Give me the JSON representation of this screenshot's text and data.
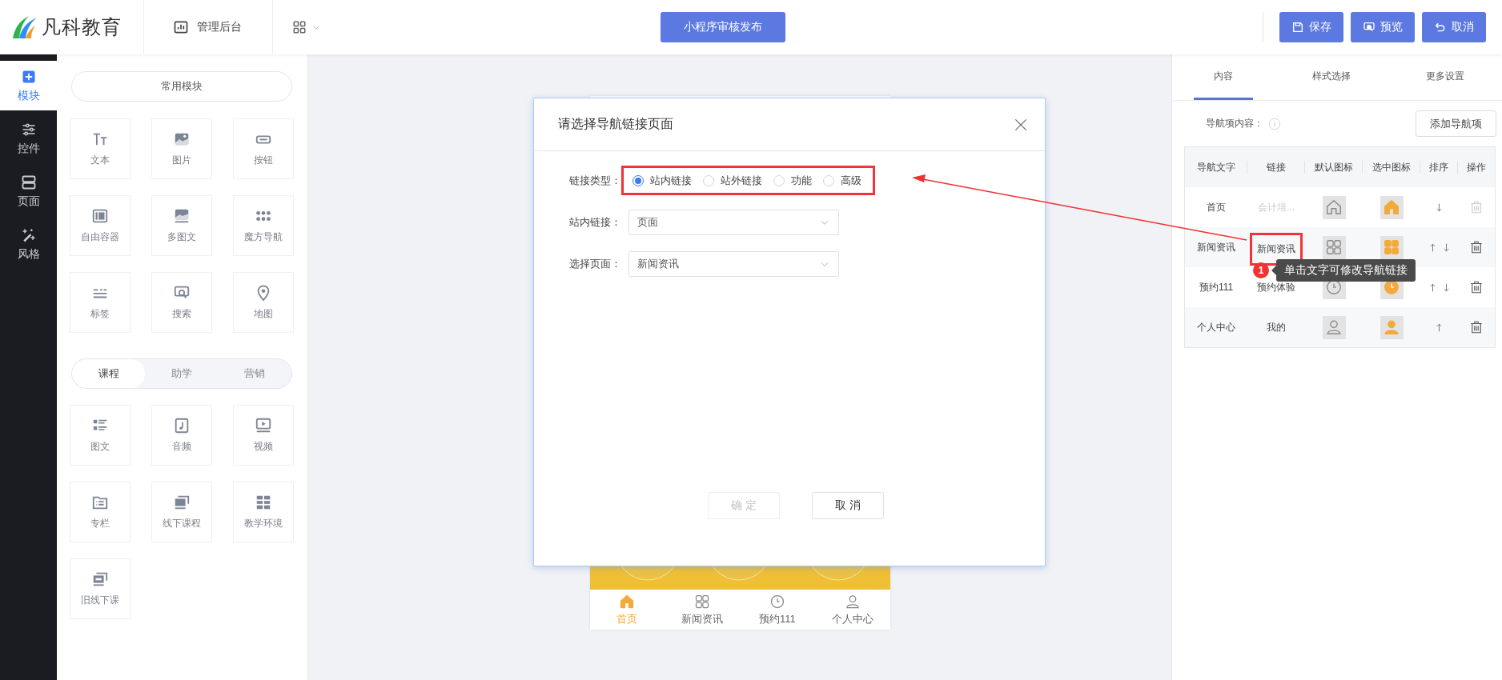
{
  "header": {
    "logo_text": "凡科教育",
    "admin_link": "管理后台",
    "publish_button": "小程序审核发布",
    "actions": [
      {
        "label": "保存",
        "kind": "save"
      },
      {
        "label": "预览",
        "kind": "search"
      },
      {
        "label": "取消",
        "kind": "undo"
      }
    ]
  },
  "rail": [
    {
      "label": "模块",
      "kind": "plus",
      "selected": true
    },
    {
      "label": "控件",
      "kind": "sliders",
      "selected": false
    },
    {
      "label": "页面",
      "kind": "page",
      "selected": false
    },
    {
      "label": "风格",
      "kind": "magic",
      "selected": false
    }
  ],
  "modules": {
    "common_title": "常用模块",
    "common": [
      {
        "label": "文本",
        "kind": "text"
      },
      {
        "label": "图片",
        "kind": "image"
      },
      {
        "label": "按钮",
        "kind": "button"
      },
      {
        "label": "自由容器",
        "kind": "container"
      },
      {
        "label": "多图文",
        "kind": "multi"
      },
      {
        "label": "魔方导航",
        "kind": "dots"
      },
      {
        "label": "标签",
        "kind": "tag"
      },
      {
        "label": "搜索",
        "kind": "search"
      },
      {
        "label": "地图",
        "kind": "map"
      }
    ],
    "tabs": [
      {
        "label": "课程",
        "selected": true
      },
      {
        "label": "助学",
        "selected": false
      },
      {
        "label": "营销",
        "selected": false
      }
    ],
    "course": [
      {
        "label": "图文",
        "kind": "list"
      },
      {
        "label": "音频",
        "kind": "audio"
      },
      {
        "label": "视频",
        "kind": "video"
      },
      {
        "label": "专栏",
        "kind": "folder"
      },
      {
        "label": "线下课程",
        "kind": "screens"
      },
      {
        "label": "教学环境",
        "kind": "tiles"
      },
      {
        "label": "旧线下课",
        "kind": "old"
      }
    ]
  },
  "phone": {
    "tabs": [
      {
        "label": "首页",
        "kind": "home",
        "selected": true
      },
      {
        "label": "新闻资讯",
        "kind": "grid",
        "selected": false
      },
      {
        "label": "预约111",
        "kind": "clock",
        "selected": false
      },
      {
        "label": "个人中心",
        "kind": "user",
        "selected": false
      }
    ]
  },
  "dialog": {
    "title": "请选择导航链接页面",
    "fields": [
      {
        "label": "链接类型：",
        "kind": "radio",
        "highlighted": true,
        "options": [
          {
            "label": "站内链接",
            "selected": true
          },
          {
            "label": "站外链接",
            "selected": false
          },
          {
            "label": "功能",
            "selected": false
          },
          {
            "label": "高级",
            "selected": false
          }
        ]
      },
      {
        "label": "站内链接：",
        "kind": "select",
        "value": "页面"
      },
      {
        "label": "选择页面：",
        "kind": "select",
        "value": "新闻资讯"
      }
    ],
    "buttons": [
      {
        "label": "确 定",
        "disabled": true
      },
      {
        "label": "取 消",
        "disabled": false
      }
    ]
  },
  "panel": {
    "tabs": [
      {
        "label": "内容",
        "selected": true
      },
      {
        "label": "样式选择",
        "selected": false
      },
      {
        "label": "更多设置",
        "selected": false
      }
    ],
    "section_label": "导航项内容：",
    "add_button": "添加导航项",
    "columns": [
      "导航文字",
      "链接",
      "默认图标",
      "选中图标",
      "排序",
      "操作"
    ],
    "rows": [
      {
        "text": "首页",
        "link": "会计培...",
        "link_muted": true,
        "highlighted": false,
        "kind": "home",
        "up": false,
        "down": true,
        "deletable": false
      },
      {
        "text": "新闻资讯",
        "link": "新闻资讯",
        "link_muted": false,
        "highlighted": true,
        "kind": "grid",
        "up": true,
        "down": true,
        "deletable": true
      },
      {
        "text": "预约111",
        "link": "预约体验",
        "link_muted": false,
        "highlighted": false,
        "kind": "clock",
        "up": true,
        "down": true,
        "deletable": true
      },
      {
        "text": "个人中心",
        "link": "我的",
        "link_muted": false,
        "highlighted": false,
        "kind": "user",
        "up": true,
        "down": false,
        "deletable": true
      }
    ]
  },
  "annotation": {
    "badge": "1",
    "tooltip": "单击文字可修改导航链接"
  }
}
